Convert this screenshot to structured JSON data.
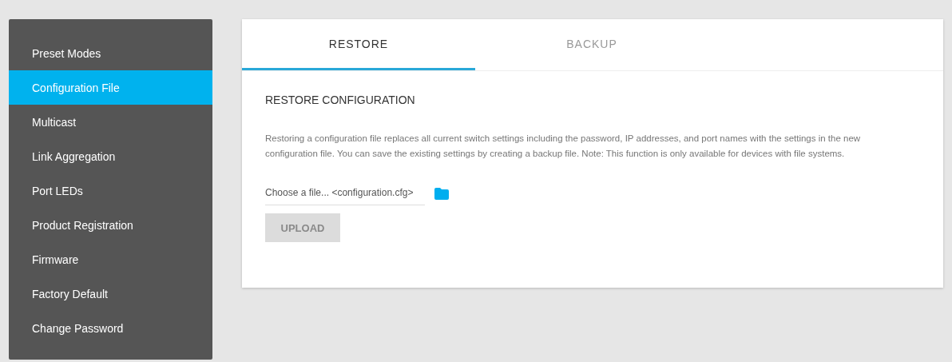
{
  "sidebar": {
    "items": [
      {
        "label": "Preset Modes",
        "selected": false
      },
      {
        "label": "Configuration File",
        "selected": true
      },
      {
        "label": "Multicast",
        "selected": false
      },
      {
        "label": "Link Aggregation",
        "selected": false
      },
      {
        "label": "Port LEDs",
        "selected": false
      },
      {
        "label": "Product Registration",
        "selected": false
      },
      {
        "label": "Firmware",
        "selected": false
      },
      {
        "label": "Factory Default",
        "selected": false
      },
      {
        "label": "Change Password",
        "selected": false
      }
    ]
  },
  "tabs": [
    {
      "label": "RESTORE",
      "selected": true
    },
    {
      "label": "BACKUP",
      "selected": false
    }
  ],
  "section": {
    "title": "RESTORE CONFIGURATION",
    "description": "Restoring a configuration file replaces all current switch settings including the password, IP addresses, and port names with the settings in the new configuration file. You can save the existing settings by creating a backup file. Note: This function is only available for devices with file systems.",
    "file_field": {
      "placeholder": "Choose a file... <configuration.cfg>"
    },
    "upload_button": {
      "label": "UPLOAD",
      "disabled": true
    }
  }
}
